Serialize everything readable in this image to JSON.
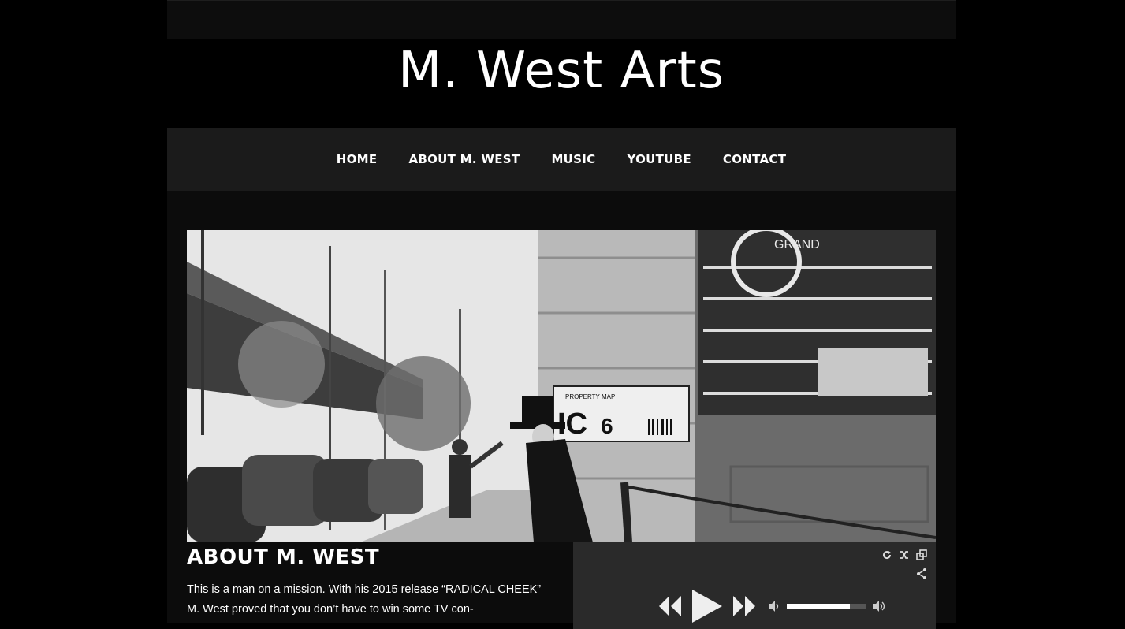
{
  "site": {
    "title": "M. West Arts"
  },
  "nav": {
    "items": [
      {
        "label": "HOME"
      },
      {
        "label": "ABOUT M. WEST"
      },
      {
        "label": "MUSIC"
      },
      {
        "label": "YOUTUBE"
      },
      {
        "label": "CONTACT"
      }
    ]
  },
  "about": {
    "heading": "ABOUT M. WEST",
    "text": "This is a man on a mission. With his 2015 release “RADICAL CHEEK” M. West proved that you don’t have to win some TV con-"
  },
  "hero": {
    "signs": {
      "grand": "GRAND",
      "property_map": "PROPERTY MAP",
      "code": "IC",
      "bldg": "6"
    }
  },
  "player": {
    "icons": [
      "repeat-icon",
      "shuffle-icon",
      "popout-icon",
      "share-icon",
      "rewind-icon",
      "play-icon",
      "fast-forward-icon",
      "volume-low-icon",
      "volume-high-icon"
    ],
    "volume": 0.8
  },
  "colors": {
    "background": "#000000",
    "nav_bg": "#1b1b1b",
    "player_bg": "#2a2a2a",
    "text": "#ffffff"
  }
}
